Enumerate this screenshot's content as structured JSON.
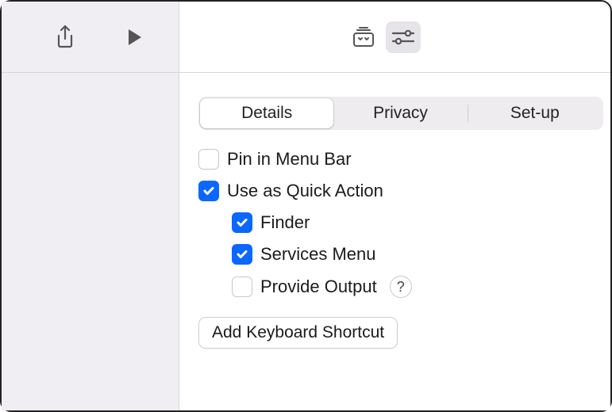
{
  "toolbar": {
    "share_icon": "share-icon",
    "play_icon": "play-icon",
    "library_icon": "library-icon",
    "inspector_icon": "sliders-icon"
  },
  "segmented": {
    "tabs": [
      "Details",
      "Privacy",
      "Set-up"
    ],
    "selected": 0
  },
  "options": {
    "pin": {
      "label": "Pin in Menu Bar",
      "checked": false
    },
    "quick_action": {
      "label": "Use as Quick Action",
      "checked": true
    },
    "finder": {
      "label": "Finder",
      "checked": true
    },
    "services": {
      "label": "Services Menu",
      "checked": true
    },
    "provide_output": {
      "label": "Provide Output",
      "checked": false
    },
    "help": "?"
  },
  "buttons": {
    "add_shortcut": "Add Keyboard Shortcut"
  }
}
